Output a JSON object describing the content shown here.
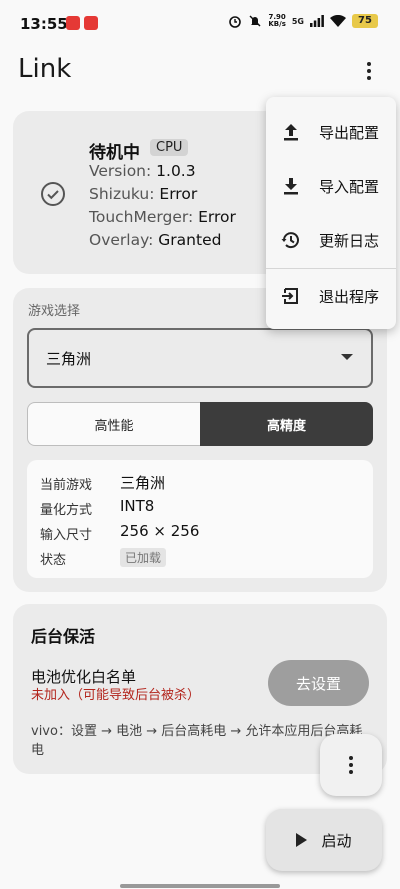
{
  "status_bar": {
    "time": "13:55",
    "net_speed_value": "7.90",
    "net_speed_unit": "KB/s",
    "network": "5G",
    "battery": "75",
    "icons": [
      "app-badge-icon",
      "app-badge-icon",
      "alarm-icon",
      "mute-icon",
      "signal-icon",
      "wifi-icon",
      "battery-icon"
    ]
  },
  "app_bar": {
    "title": "Link",
    "overflow_icon": "more-vert-icon"
  },
  "status_card": {
    "title": "待机中",
    "chip": "CPU",
    "icon": "check-circle-icon",
    "rows": [
      {
        "label": "Version: ",
        "value": "1.0.3"
      },
      {
        "label": "Shizuku: ",
        "value": "Error"
      },
      {
        "label": "TouchMerger: ",
        "value": "Error"
      },
      {
        "label": "Overlay: ",
        "value": "Granted"
      }
    ]
  },
  "game_card": {
    "section_label": "游戏选择",
    "dropdown_value": "三角洲",
    "segments": {
      "left": "高性能",
      "right": "高精度",
      "selected": "right"
    },
    "info": {
      "game_key": "当前游戏",
      "game_val": "三角洲",
      "quant_key": "量化方式",
      "quant_val": "INT8",
      "input_key": "输入尺寸",
      "input_val": "256 × 256",
      "state_key": "状态",
      "state_val": "已加载"
    }
  },
  "bg_card": {
    "title": "后台保活",
    "item_label": "电池优化白名单",
    "warning": "未加入（可能导致后台被杀）",
    "button": "去设置",
    "hint": "vivo：设置 → 电池 → 后台高耗电 → 允许本应用后台高耗电"
  },
  "fab": {
    "more_icon": "more-vert-icon",
    "start_label": "启动",
    "start_icon": "play-icon"
  },
  "menu": {
    "items": [
      {
        "label": "导出配置",
        "icon": "upload-icon"
      },
      {
        "label": "导入配置",
        "icon": "download-icon"
      },
      {
        "label": "更新日志",
        "icon": "history-icon"
      },
      {
        "label": "退出程序",
        "icon": "exit-icon"
      }
    ]
  }
}
